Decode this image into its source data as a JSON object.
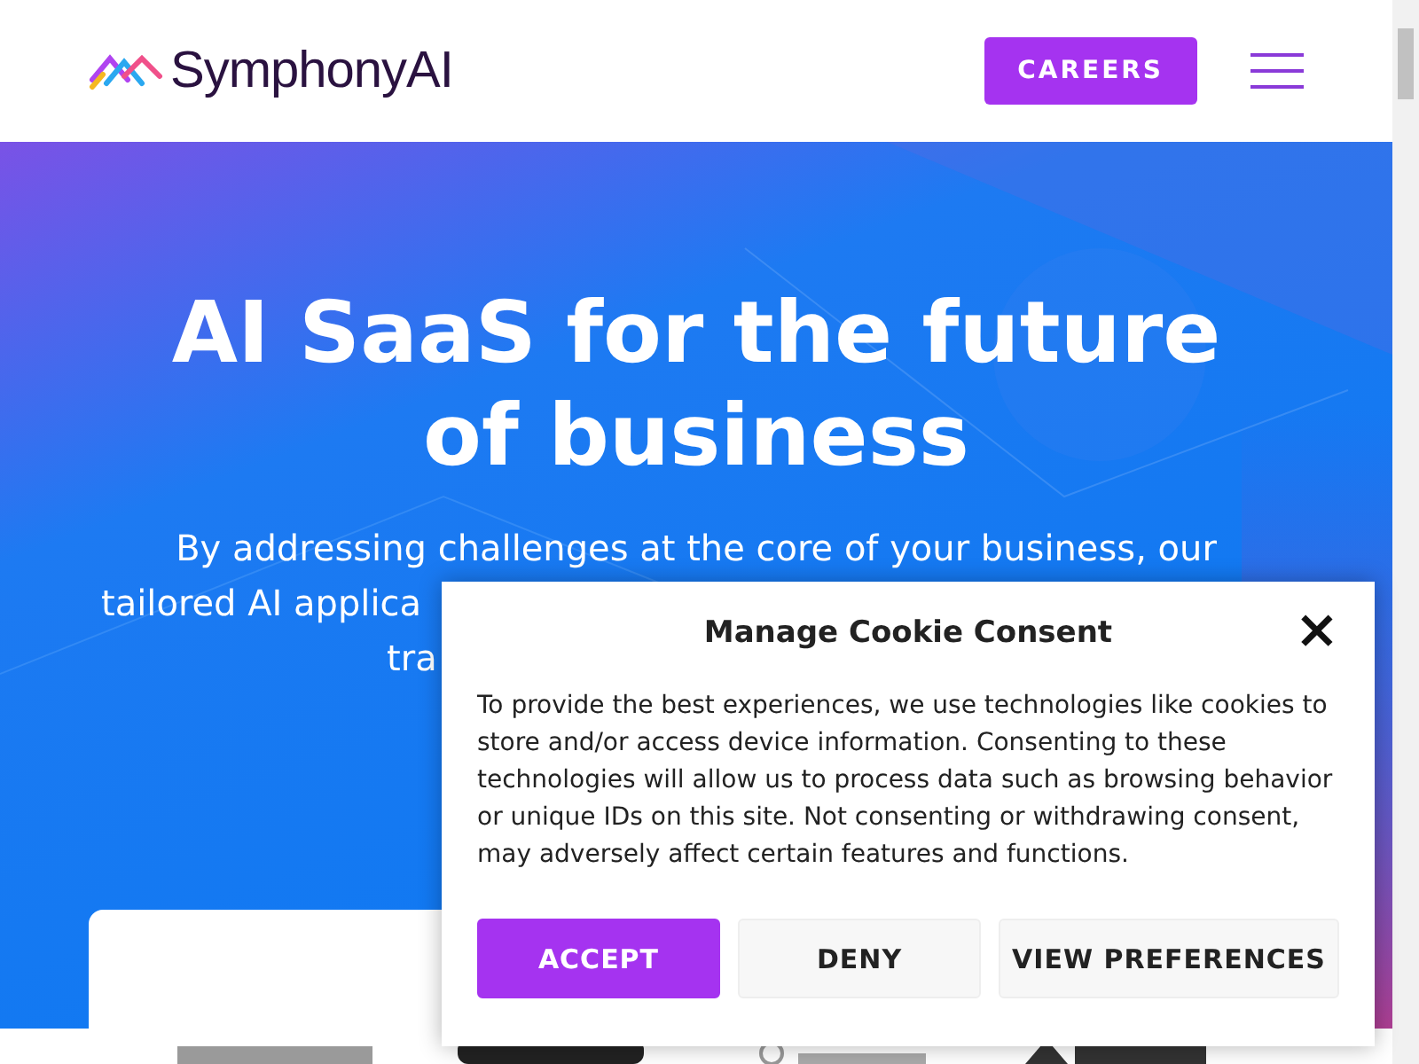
{
  "header": {
    "logo_text": "SymphonyAI",
    "careers_button": "CAREERS"
  },
  "hero": {
    "title": "AI SaaS for the future of business",
    "subtitle_lines": [
      "By addressing challenges at the core of your business, our",
      "tailored AI applica",
      "tra"
    ]
  },
  "cookie_dialog": {
    "title": "Manage Cookie Consent",
    "close": "×",
    "body": "To provide the best experiences, we use technologies like cookies to store and/or access device information. Consenting to these technologies will allow us to process data such as browsing behavior or unique IDs on this site. Not consenting or withdrawing consent, may adversely affect certain features and functions.",
    "buttons": [
      {
        "label": "ACCEPT",
        "kind": "primary"
      },
      {
        "label": "DENY",
        "kind": "secondary"
      },
      {
        "label": "VIEW PREFERENCES",
        "kind": "secondary"
      }
    ]
  }
}
